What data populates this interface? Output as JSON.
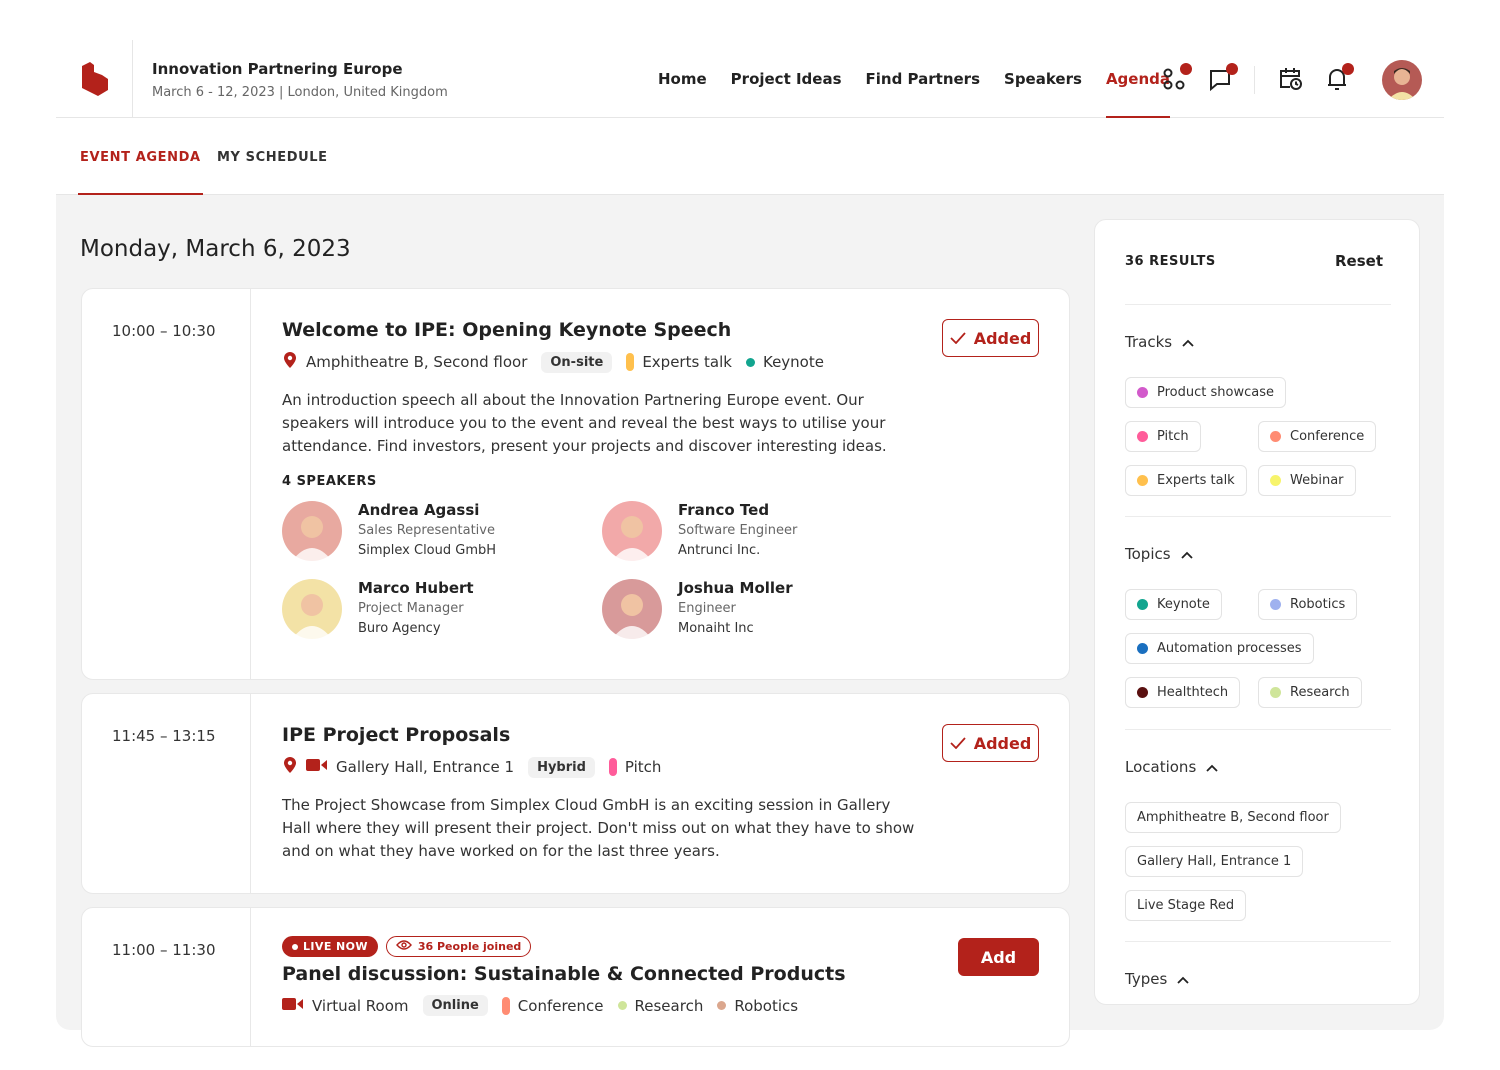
{
  "header": {
    "event_title": "Innovation Partnering Europe",
    "event_subtitle": "March 6 - 12, 2023 | London, United Kingdom",
    "nav": [
      {
        "label": "Home"
      },
      {
        "label": "Project Ideas"
      },
      {
        "label": "Find Partners"
      },
      {
        "label": "Speakers"
      },
      {
        "label": "Agenda",
        "active": true
      }
    ],
    "icons": [
      "apps-icon",
      "chat-icon",
      "calendar-clock-icon",
      "bell-icon"
    ],
    "accent": "#b3221b"
  },
  "tabs": [
    {
      "label": "EVENT AGENDA",
      "active": true
    },
    {
      "label": "MY SCHEDULE"
    }
  ],
  "date_heading": "Monday, March 6, 2023",
  "events": [
    {
      "time": "10:00 – 10:30",
      "title": "Welcome to IPE: Opening Keynote Speech",
      "action": "Added",
      "meta": [
        {
          "type": "pin",
          "text": "Amphitheatre B, Second floor"
        },
        {
          "type": "pill",
          "text": "On-site"
        },
        {
          "type": "bar",
          "color": "#ffc04d",
          "text": "Experts talk"
        },
        {
          "type": "dot",
          "color": "#12a58f",
          "text": "Keynote"
        }
      ],
      "description": "An introduction speech all about the Innovation Partnering Europe event. Our speakers will introduce you to the event and reveal the best ways to utilise your attendance. Find investors, present your projects and discover interesting ideas.",
      "speakers_heading": "4 SPEAKERS",
      "speakers": [
        {
          "name": "Andrea Agassi",
          "role": "Sales Representative",
          "company": "Simplex Cloud GmbH",
          "color": "#e8a9a0"
        },
        {
          "name": "Franco Ted",
          "role": "Software Engineer",
          "company": "Antrunci Inc.",
          "color": "#f2a9a9"
        },
        {
          "name": "Marco Hubert",
          "role": "Project Manager",
          "company": "Buro Agency",
          "color": "#f3e2a6"
        },
        {
          "name": "Joshua Moller",
          "role": "Engineer",
          "company": "Monaiht Inc",
          "color": "#d89a9a"
        }
      ]
    },
    {
      "time": "11:45 – 13:15",
      "title": "IPE Project Proposals",
      "action": "Added",
      "meta": [
        {
          "type": "pin-video",
          "text": "Gallery Hall, Entrance 1"
        },
        {
          "type": "pill",
          "text": "Hybrid"
        },
        {
          "type": "bar",
          "color": "#ff5c9a",
          "text": "Pitch"
        }
      ],
      "description": "The Project Showcase from Simplex Cloud GmbH is an exciting session in Gallery Hall where they will present their project. Don't miss out on what they have to show and on what they have worked on for the last three years."
    },
    {
      "time": "11:00 – 11:30",
      "title": "Panel discussion: Sustainable & Connected Products",
      "action": "Add",
      "live_label": "LIVE NOW",
      "joined_label": "36 People joined",
      "meta": [
        {
          "type": "video",
          "text": "Virtual Room"
        },
        {
          "type": "pill",
          "text": "Online"
        },
        {
          "type": "bar",
          "color": "#ff8c73",
          "text": "Conference"
        },
        {
          "type": "dot",
          "color": "#cfe59a",
          "text": "Research"
        },
        {
          "type": "dot",
          "color": "#dba78e",
          "text": "Robotics"
        }
      ]
    }
  ],
  "filters": {
    "results": "36 RESULTS",
    "reset": "Reset",
    "sections": [
      {
        "title": "Tracks",
        "chips": [
          {
            "label": "Product showcase",
            "color": "#d25acb",
            "full": true
          },
          {
            "label": "Pitch",
            "color": "#ff5c9a"
          },
          {
            "label": "Conference",
            "color": "#ff8c73"
          },
          {
            "label": "Experts talk",
            "color": "#ffc04d"
          },
          {
            "label": "Webinar",
            "color": "#f7f46b"
          }
        ]
      },
      {
        "title": "Topics",
        "chips": [
          {
            "label": "Keynote",
            "color": "#12a58f"
          },
          {
            "label": "Robotics",
            "color": "#9fb1ef"
          },
          {
            "label": "Automation processes",
            "color": "#1a6fbf",
            "full": true
          },
          {
            "label": "Healthtech",
            "color": "#5a1010"
          },
          {
            "label": "Research",
            "color": "#cfe59a"
          }
        ]
      },
      {
        "title": "Locations",
        "single": true,
        "chips": [
          {
            "label": "Amphitheatre B, Second floor"
          },
          {
            "label": "Gallery Hall, Entrance 1"
          },
          {
            "label": "Live Stage Red"
          }
        ]
      },
      {
        "title": "Types",
        "chips": []
      }
    ]
  }
}
